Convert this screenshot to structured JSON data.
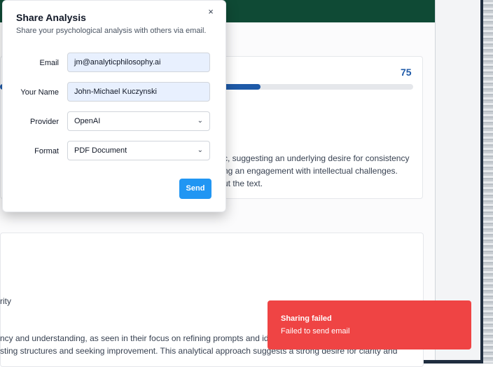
{
  "background": {
    "score": "75",
    "progress_fraction": 0.63,
    "card1_lines": [
      "c, suggesting an underlying desire for consistency",
      "ng an engagement with intellectual challenges.",
      "ut the text."
    ],
    "card2_lines": [
      "rity",
      "ncy and understanding, as seen in their focus on refining prompts and ide",
      "sting structures and seeking improvement. This analytical approach suggests a strong desire for clarity and"
    ]
  },
  "modal": {
    "title": "Share Analysis",
    "subtitle": "Share your psychological analysis with others via email.",
    "close_label": "×",
    "fields": {
      "email": {
        "label": "Email",
        "value": "jm@analyticphilosophy.ai"
      },
      "name": {
        "label": "Your Name",
        "value": "John-Michael Kuczynski"
      },
      "provider": {
        "label": "Provider",
        "value": "OpenAI"
      },
      "format": {
        "label": "Format",
        "value": "PDF Document"
      }
    },
    "chevron": "⌄",
    "send_label": "Send"
  },
  "toast": {
    "title": "Sharing failed",
    "message": "Failed to send email",
    "color": "#ef4444"
  }
}
